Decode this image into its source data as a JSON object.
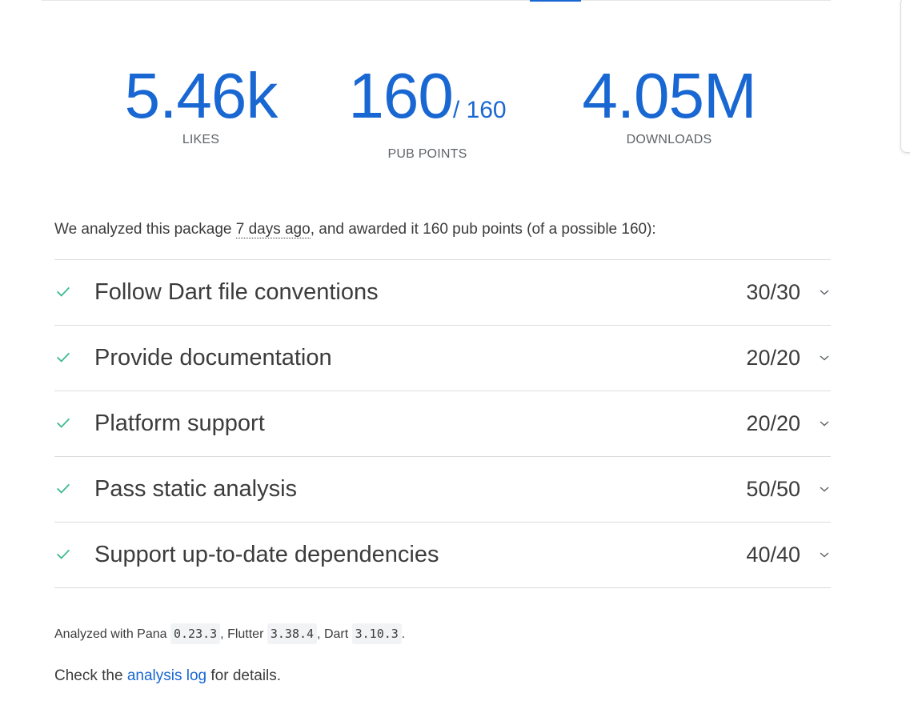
{
  "stats": {
    "likes": {
      "value": "5.46k",
      "label": "LIKES"
    },
    "points": {
      "value": "160",
      "max": "/ 160",
      "label": "PUB POINTS"
    },
    "downloads": {
      "value": "4.05M",
      "label": "DOWNLOADS"
    }
  },
  "summary": {
    "prefix": "We analyzed this package ",
    "age": "7 days ago",
    "suffix": ", and awarded it 160 pub points (of a possible 160):"
  },
  "sections": [
    {
      "title": "Follow Dart file conventions",
      "score": "30/30"
    },
    {
      "title": "Provide documentation",
      "score": "20/20"
    },
    {
      "title": "Platform support",
      "score": "20/20"
    },
    {
      "title": "Pass static analysis",
      "score": "50/50"
    },
    {
      "title": "Support up-to-date dependencies",
      "score": "40/40"
    }
  ],
  "versions": {
    "prefix": "Analyzed with Pana ",
    "pana": "0.23.3",
    "flutter_label": ", Flutter ",
    "flutter": "3.38.4",
    "dart_label": ", Dart ",
    "dart": "3.10.3",
    "end": "."
  },
  "details": {
    "prefix": "Check the ",
    "link": "analysis log",
    "suffix": " for details."
  },
  "icons": {
    "check": "check-icon",
    "chevron": "chevron-down-icon"
  },
  "colors": {
    "accent": "#1967d2",
    "check": "#3dbb95",
    "text": "#3c3c3c",
    "muted": "#5f6368"
  }
}
